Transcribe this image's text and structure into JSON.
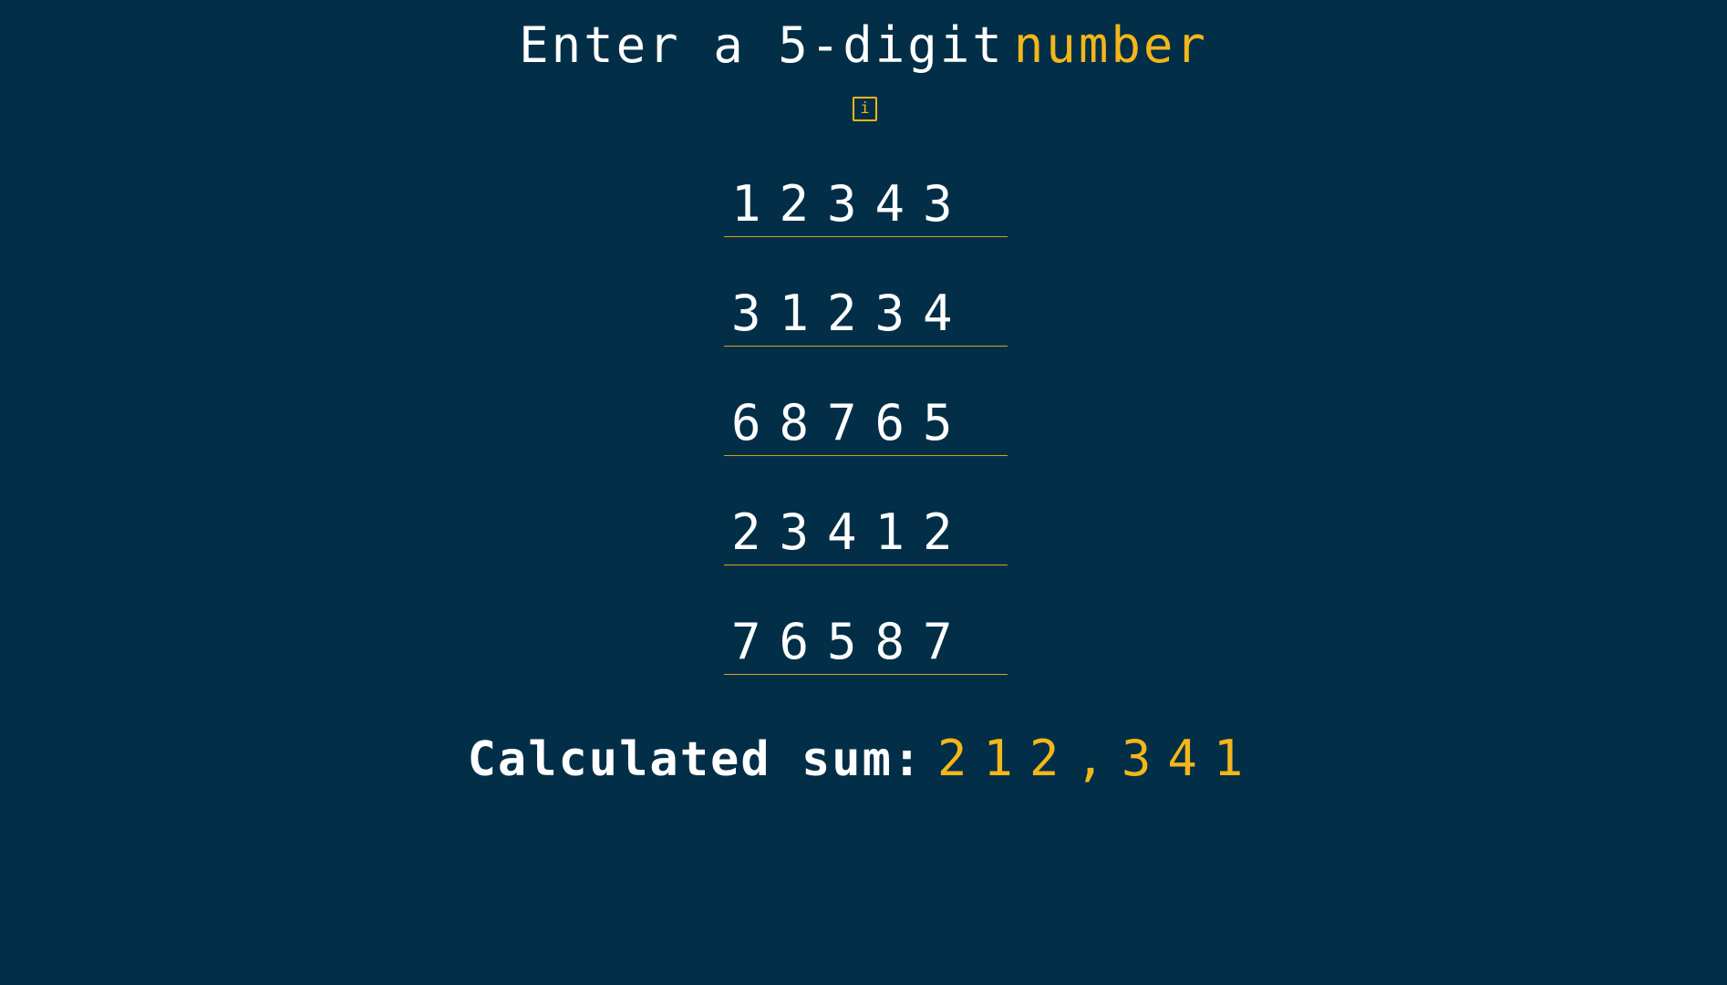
{
  "header": {
    "title_prefix": "Enter a 5-digit",
    "title_accent": "number",
    "info_icon": "info-icon",
    "info_glyph": "i"
  },
  "inputs": [
    {
      "value": "12343"
    },
    {
      "value": "31234"
    },
    {
      "value": "68765"
    },
    {
      "value": "23412"
    },
    {
      "value": "76587"
    }
  ],
  "result": {
    "label": "Calculated sum:",
    "value": "212,341"
  },
  "colors": {
    "background": "#022f47",
    "accent": "#f4b61a",
    "text": "#ffffff"
  }
}
